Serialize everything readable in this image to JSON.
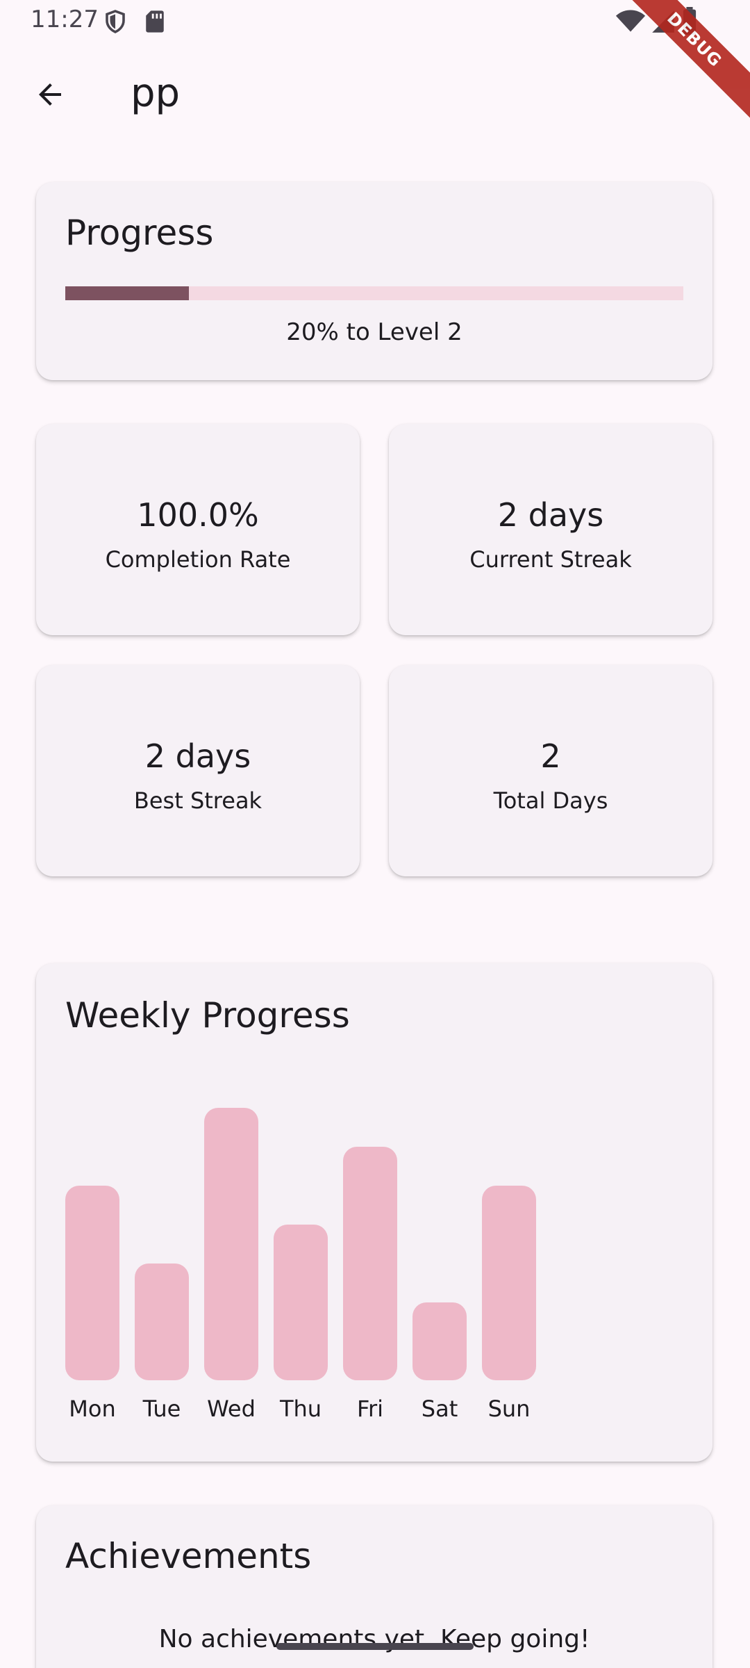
{
  "status_bar": {
    "time": "11:27",
    "icons": [
      "shield-icon",
      "sd-card-icon",
      "wifi-icon",
      "signal-icon",
      "battery-icon"
    ],
    "debug_label": "DEBUG"
  },
  "app_bar": {
    "back_icon": "arrow-back-icon",
    "title": "pp"
  },
  "progress_card": {
    "title": "Progress",
    "progress_fraction": 0.2,
    "caption": "20% to Level 2"
  },
  "stats": [
    {
      "value": "100.0%",
      "label": "Completion Rate"
    },
    {
      "value": "2 days",
      "label": "Current Streak"
    },
    {
      "value": "2 days",
      "label": "Best Streak"
    },
    {
      "value": "2",
      "label": "Total Days"
    }
  ],
  "weekly_card": {
    "title": "Weekly Progress"
  },
  "chart_data": {
    "type": "bar",
    "categories": [
      "Mon",
      "Tue",
      "Wed",
      "Thu",
      "Fri",
      "Sat",
      "Sun"
    ],
    "values": [
      5,
      3,
      7,
      4,
      6,
      2,
      5
    ],
    "ylim": [
      0,
      7
    ],
    "grid": false,
    "bar_color": "#eeb8c8"
  },
  "achievements_card": {
    "title": "Achievements",
    "empty_message": "No achievements yet. Keep going!"
  },
  "colors": {
    "background": "#fdf7fb",
    "card": "#f6f1f6",
    "progress_fill": "#7d5260",
    "progress_track": "#f4d9e2",
    "bar": "#eeb8c8",
    "debug_ribbon": "#b3261e"
  }
}
